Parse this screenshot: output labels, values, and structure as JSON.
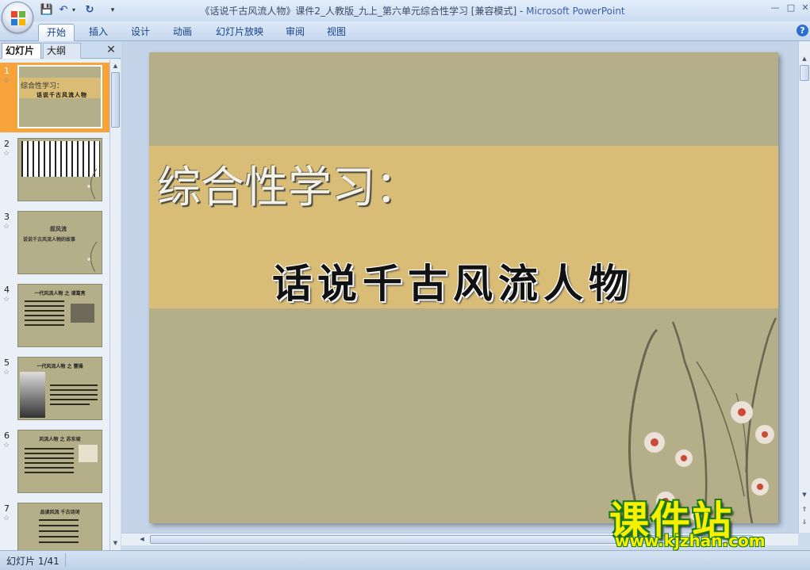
{
  "window": {
    "title": "《话说千古风流人物》课件2_人教版_九上_第六单元综合性学习 [兼容模式] - ",
    "app_name": "Microsoft PowerPoint",
    "minimize": "—",
    "maximize": "□",
    "close": "✕"
  },
  "quick_access": {
    "save": "💾",
    "undo": "↶",
    "undo_dropdown": "▾",
    "redo": "↻",
    "customize": "▾"
  },
  "ribbon": {
    "tabs": [
      "开始",
      "插入",
      "设计",
      "动画",
      "幻灯片放映",
      "审阅",
      "视图"
    ],
    "active_tab": "开始",
    "help": "?"
  },
  "slide_pane": {
    "tabs": [
      "幻灯片",
      "大纲"
    ],
    "close": "✕",
    "selected": 1,
    "thumbnails": [
      {
        "number": "1",
        "line1": "综合性学习：",
        "line2": "话说千古风流人物"
      },
      {
        "number": "2"
      },
      {
        "number": "3",
        "line1": "叙风流",
        "line2": "说说千古风流人物的故事"
      },
      {
        "number": "4",
        "line1": "一代风流人物 之 诸葛亮"
      },
      {
        "number": "5",
        "line1": "一代风流人物 之 曹操"
      },
      {
        "number": "6",
        "line1": "风流人物 之 苏东坡"
      },
      {
        "number": "7",
        "line1": "品读风流 千古诗词"
      }
    ],
    "anim_marker": "☆"
  },
  "slide": {
    "title": "综合性学习：",
    "subtitle": "话说千古风流人物",
    "colors": {
      "background": "#b4ae89",
      "band": "#d9bd77",
      "title_text": "#f4f1e6"
    }
  },
  "scrollbars": {
    "up": "▲",
    "down": "▼",
    "left": "◀",
    "right": "▶",
    "prev_slide": "⇑",
    "next_slide": "⇓"
  },
  "status_bar": {
    "slide_count": "幻灯片 1/41"
  },
  "watermark": {
    "text": "课件站",
    "url": "www.kjzhan.com"
  }
}
